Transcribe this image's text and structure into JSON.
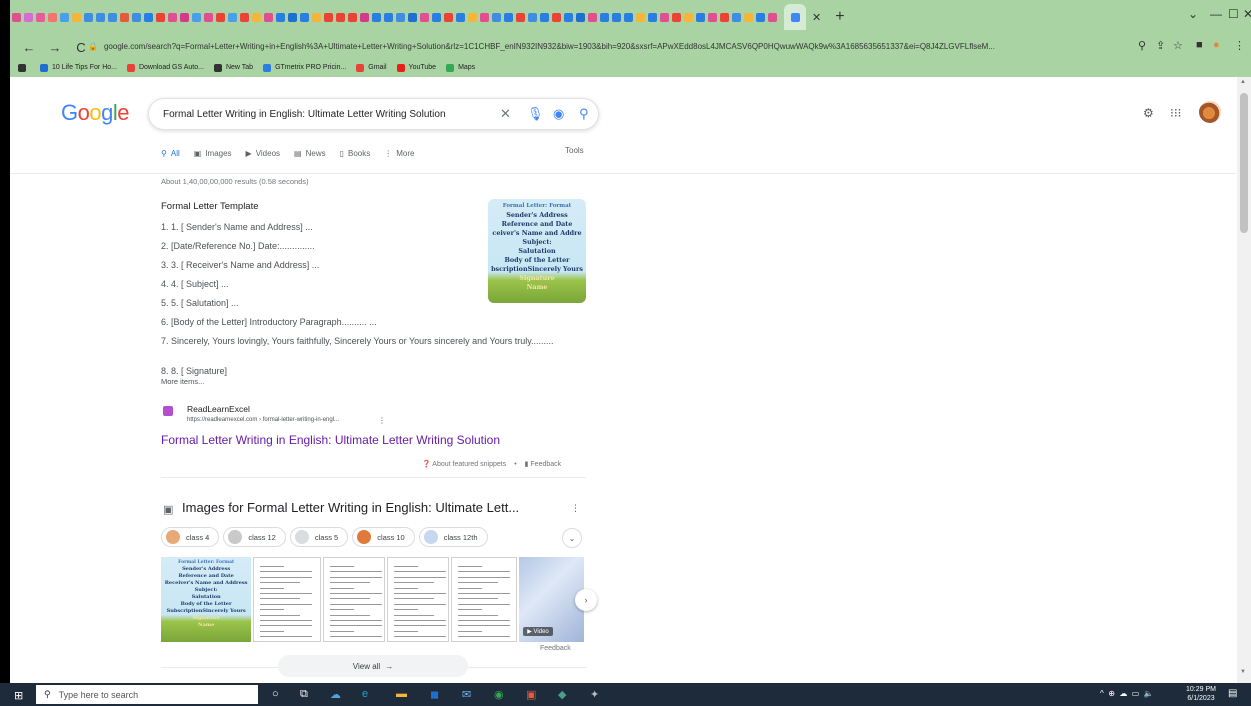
{
  "browser": {
    "tab_favicon_colors": [
      "#e04f8f",
      "#d66bd1",
      "#e85b9a",
      "#f2766f",
      "#4b9fe8",
      "#f4b63a",
      "#3f8de0",
      "#3f8de0",
      "#3f8de0",
      "#e15b3c",
      "#3f8de0",
      "#2a7de1",
      "#ea4335",
      "#e04f8f",
      "#d13b8a",
      "#4b9fe8",
      "#e04f8f",
      "#ea4335",
      "#4b9fe8",
      "#ea4335",
      "#f4b63a",
      "#e04f8f",
      "#2a7de1",
      "#1f6fd1",
      "#2a7de1",
      "#f4b63a",
      "#ea4335",
      "#ea4335",
      "#ea4335",
      "#d13b8a",
      "#2a7de1",
      "#2a7de1",
      "#3f8de0",
      "#1f6fd1",
      "#e04f8f",
      "#2a7de1",
      "#ea4335",
      "#2a7de1",
      "#f4b63a",
      "#e04f8f",
      "#3f8de0",
      "#2a7de1",
      "#ea4335",
      "#3f8de0",
      "#2a7de1",
      "#ea4335",
      "#2a7de1",
      "#1f6fd1",
      "#e04f8f",
      "#2a7de1",
      "#2a7de1",
      "#2a7de1",
      "#f4b63a",
      "#2a7de1",
      "#e04f8f",
      "#ea4335",
      "#f4b63a",
      "#2a7de1",
      "#e04f8f",
      "#ea4335",
      "#3f8de0",
      "#f4b63a",
      "#2a7de1",
      "#e04f8f"
    ],
    "url": "google.com/search?q=Formal+Letter+Writing+in+English%3A+Ultimate+Letter+Writing+Solution&rlz=1C1CHBF_enIN932IN932&biw=1903&bih=920&sxsrf=APwXEdd8osL4JMCASV6QP0HQwuwWAQk9w%3A1685635651337&ei=Q8J4ZLGVFLflseM...",
    "bookmarks": [
      {
        "label": "10 Life Tips For Ho...",
        "color": "#1f6fd1"
      },
      {
        "label": "Download GS Auto...",
        "color": "#ea4335"
      },
      {
        "label": "New Tab",
        "color": "#333333"
      },
      {
        "label": "GTmetrix PRO Pricin...",
        "color": "#2a7de1"
      },
      {
        "label": "Gmail",
        "color": "#ea4335"
      },
      {
        "label": "YouTube",
        "color": "#e62117"
      },
      {
        "label": "Maps",
        "color": "#34a853"
      }
    ]
  },
  "google": {
    "logo": "Google",
    "query": "Formal Letter Writing in English: Ultimate Letter Writing Solution",
    "tabs": [
      "All",
      "Images",
      "Videos",
      "News",
      "Books",
      "More"
    ],
    "tools": "Tools",
    "stats": "About 1,40,00,00,000 results (0.58 seconds)",
    "featured": {
      "title": "Formal Letter Template",
      "items": [
        "1. 1. [ Sender's Name and Address] ...",
        "2. [Date/Reference No.] Date:..............",
        "3. 3. [ Receiver's Name and Address] ...",
        "4. 4. [ Subject] ...",
        "5. 5. [ Salutation] ...",
        "6. [Body of the Letter] Introductory Paragraph.......... ...",
        "7. Sincerely, Yours lovingly, Yours faithfully, Sincerely Yours or Yours sincerely and Yours truly.........",
        "8. 8. [ Signature]"
      ],
      "more_items": "More items...",
      "thumb_lines": [
        "Formal Letter: Format",
        "Sender's Address",
        "Reference and Date",
        "ceiver's Name and Addre",
        "Subject:",
        "Salutation",
        "Body of the Letter",
        "bscriptionSincerely Yours",
        "Signature",
        "Name"
      ],
      "source_name": "ReadLearnExcel",
      "source_url": "https://readlearnexcel.com › formal-letter-writing-in-engl...",
      "result_link": "Formal Letter Writing in English: Ultimate Letter Writing Solution",
      "about": "About featured snippets",
      "feedback": "Feedback"
    },
    "images_section": {
      "title": "Images for Formal Letter Writing in English: Ultimate Lett...",
      "chips": [
        {
          "label": "class 4",
          "color": "#e9a877"
        },
        {
          "label": "class 12",
          "color": "#c9c9c9"
        },
        {
          "label": "class 5",
          "color": "#d9dde0"
        },
        {
          "label": "class 10",
          "color": "#e07a3a"
        },
        {
          "label": "class 12th",
          "color": "#c6d8ef"
        }
      ],
      "img1_lines": [
        "Formal Letter: Format",
        "Sender's Address",
        "Reference and Date",
        "Receiver's Name and Address",
        "Subject:",
        "Salutation",
        "Body of the Letter",
        "SubscriptionSincerely Yours",
        "Signature",
        "Name"
      ],
      "video_label": "▶ Video",
      "feedback": "Feedback",
      "view_all": "View all"
    }
  },
  "taskbar": {
    "search_placeholder": "Type here to search",
    "time": "10:29 PM",
    "date": "6/1/2023"
  },
  "colors": {
    "chrome_bg": "#a9d3a3",
    "google_blue": "#4285f4",
    "google_red": "#ea4335",
    "google_yellow": "#fbbc05",
    "google_green": "#34a853",
    "visited_link": "#681da8",
    "taskbar_bg": "#1e2b3a"
  }
}
